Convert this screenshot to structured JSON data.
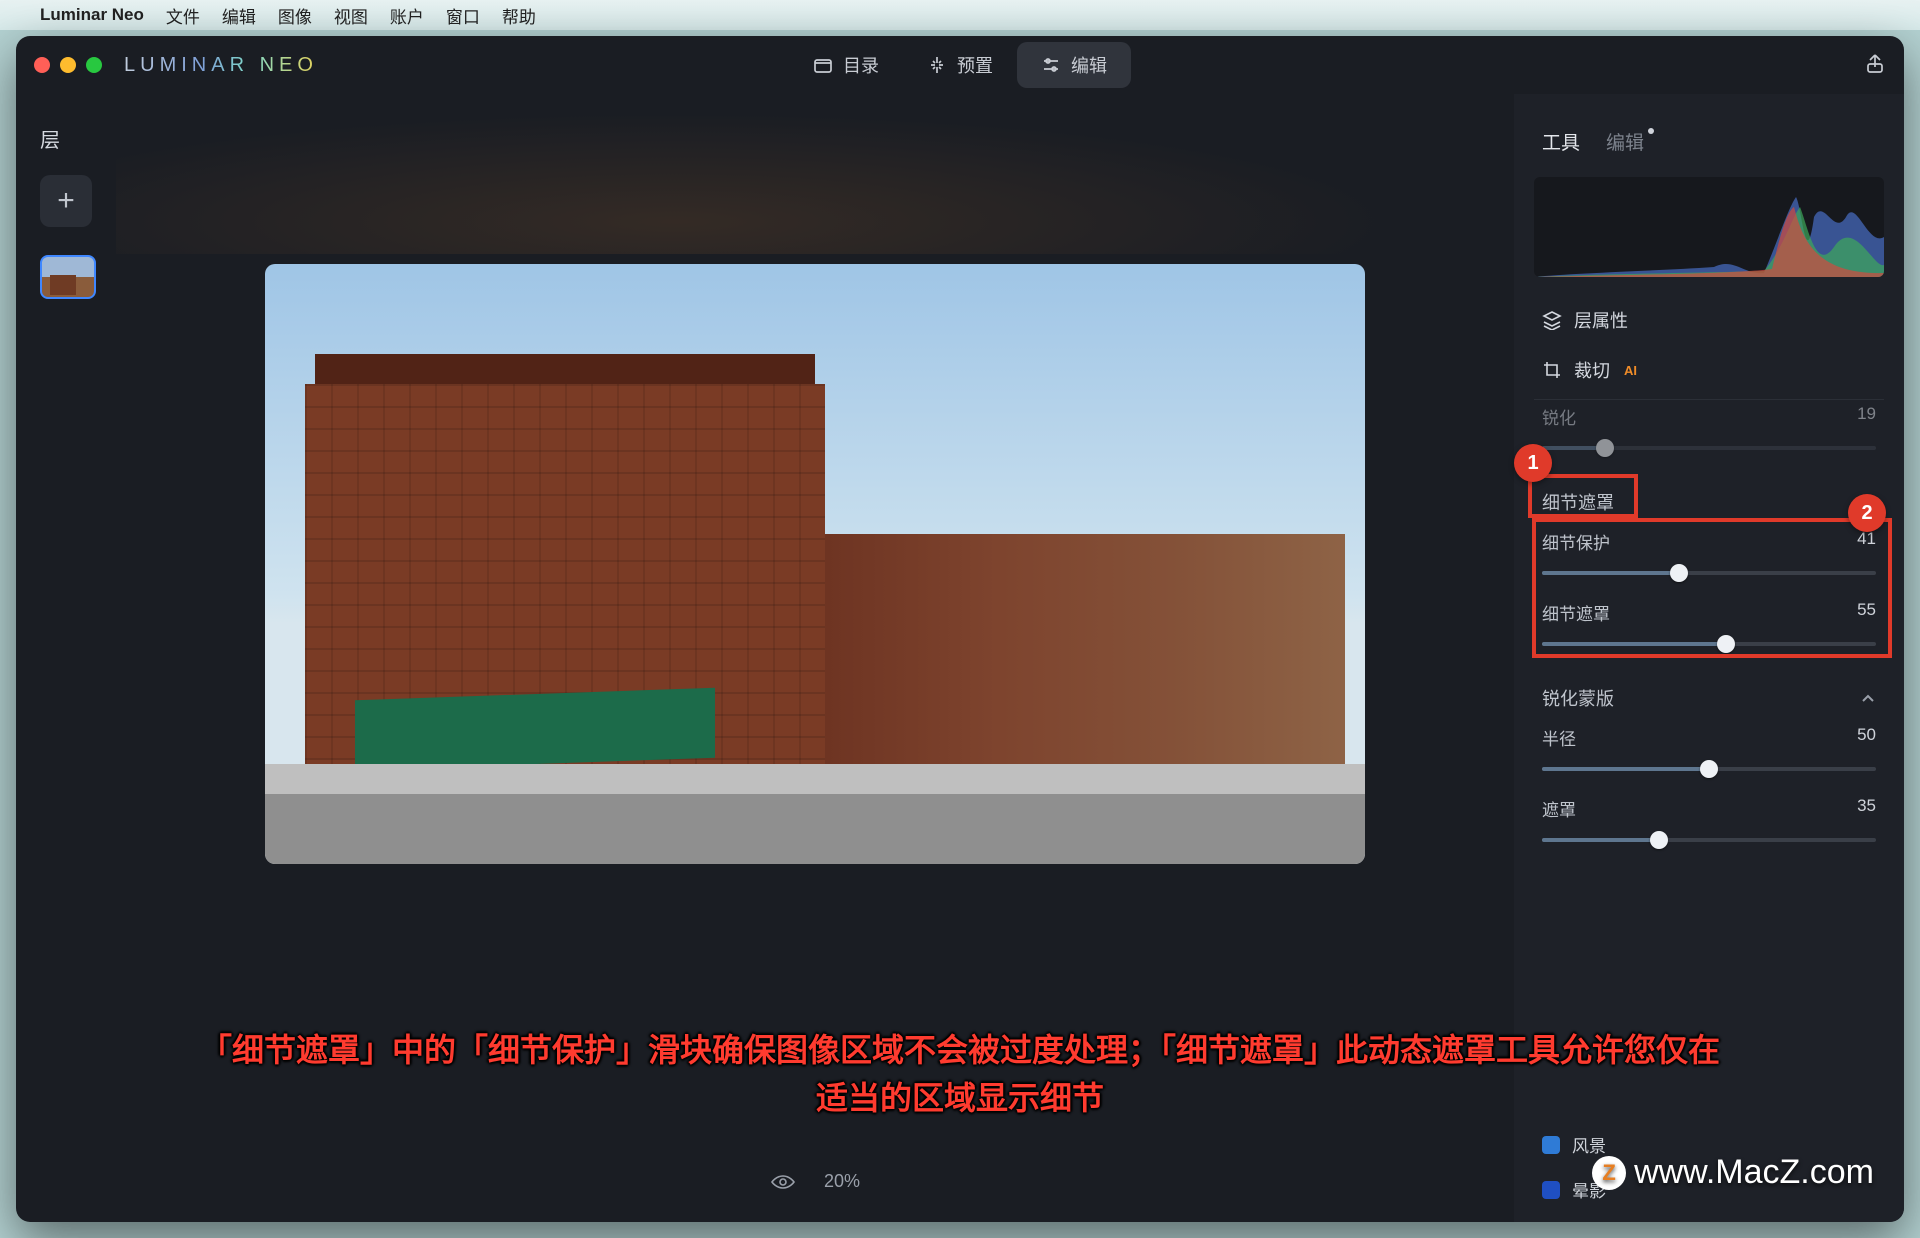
{
  "menubar": {
    "app": "Luminar Neo",
    "items": [
      "文件",
      "编辑",
      "图像",
      "视图",
      "账户",
      "窗口",
      "帮助"
    ]
  },
  "logo": "LUMINAR NEO",
  "top_tabs": {
    "catalog": "目录",
    "presets": "预置",
    "edit": "编辑"
  },
  "layers": {
    "title": "层"
  },
  "footer": {
    "zoom": "20%"
  },
  "panel": {
    "tabs": {
      "tools": "工具",
      "edits": "编辑"
    },
    "layer_props": "层属性",
    "crop": "裁切",
    "sharpen": {
      "label": "锐化",
      "value": "19"
    },
    "detail_mask_section": "细节遮罩",
    "detail_protect": {
      "label": "细节保护",
      "value": "41",
      "pct": 41
    },
    "detail_mask": {
      "label": "细节遮罩",
      "value": "55",
      "pct": 55
    },
    "sharpen_mask_section": "锐化蒙版",
    "radius": {
      "label": "半径",
      "value": "50",
      "pct": 50
    },
    "mask": {
      "label": "遮罩",
      "value": "35",
      "pct": 35
    },
    "cat_landscape": "风景",
    "cat_vignette": "晕影"
  },
  "annotations": {
    "b1": "1",
    "b2": "2"
  },
  "caption_line1": "「细节遮罩」中的「细节保护」滑块确保图像区域不会被过度处理；「细节遮罩」此动态遮罩工具允许您仅在",
  "caption_line2": "适当的区域显示细节",
  "watermark": "www.MacZ.com",
  "wm_badge": "Z"
}
